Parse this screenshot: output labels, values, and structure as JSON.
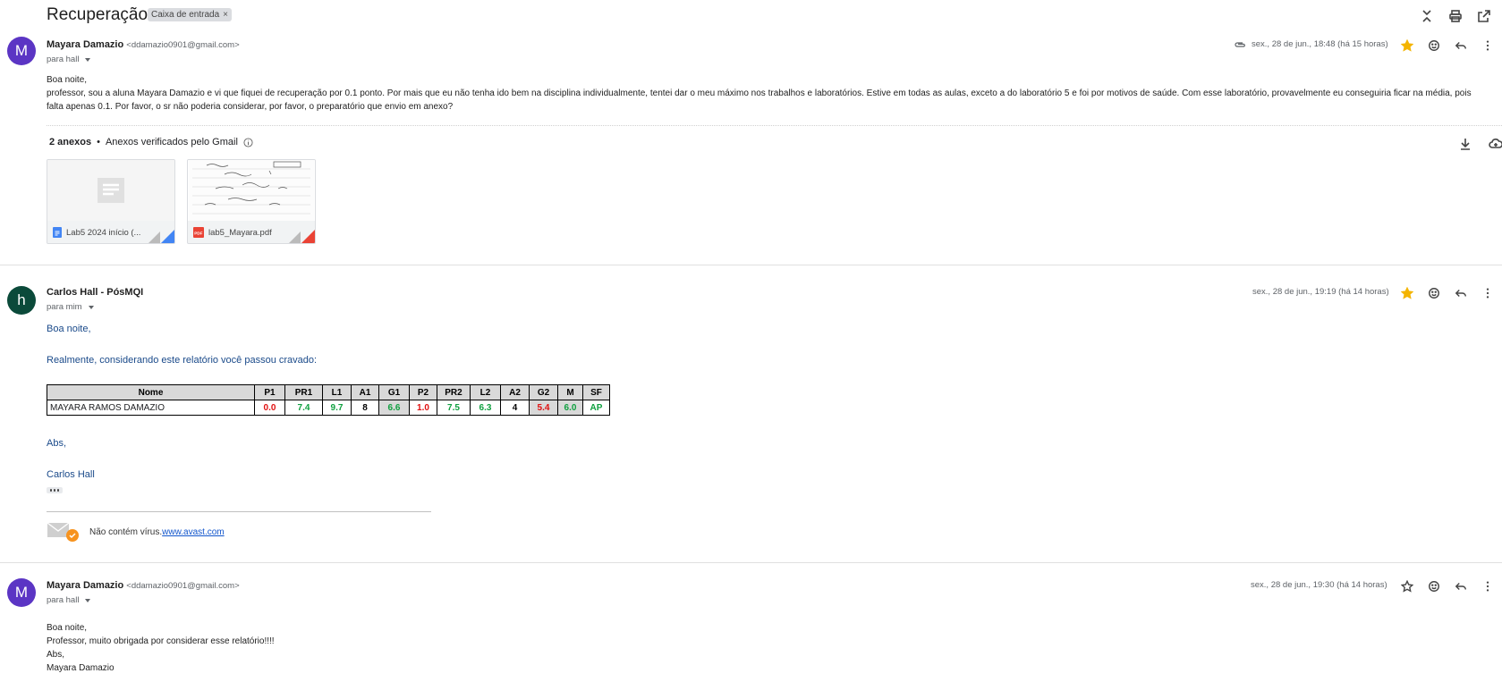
{
  "thread": {
    "subject": "Recuperação",
    "label": "Caixa de entrada"
  },
  "messages": [
    {
      "avatar_letter": "M",
      "avatar_color": "#5b35c4",
      "sender": "Mayara Damazio",
      "email": "<ddamazio0901@gmail.com>",
      "to": "para hall",
      "date": "sex., 28 de jun., 18:48 (há 15 horas)",
      "starred": true,
      "greeting": "Boa noite,",
      "body": "professor, sou a aluna Mayara Damazio e vi que fiquei de recuperação por 0.1 ponto. Por mais que eu não tenha ido bem na disciplina individualmente, tentei dar o meu máximo nos trabalhos e laboratórios. Estive em todas as aulas, exceto a do laboratório 5 e foi por motivos de saúde. Com esse laboratório, provavelmente eu conseguiria ficar na média, pois falta apenas 0.1. Por favor, o sr não poderia considerar, por favor, o preparatório que envio em anexo?",
      "attachments_count": "2 anexos",
      "attachments_verified": "Anexos verificados pelo Gmail",
      "attachments": [
        {
          "name": "Lab5 2024 início (...",
          "type": "doc"
        },
        {
          "name": "lab5_Mayara.pdf",
          "type": "pdf"
        }
      ]
    },
    {
      "avatar_letter": "h",
      "avatar_color": "#0b4a3a",
      "sender": "Carlos Hall - PósMQI",
      "to": "para mim",
      "date": "sex., 28 de jun., 19:19 (há 14 horas)",
      "starred": true,
      "greeting": "Boa noite,",
      "line1": "Realmente, considerando este relatório você passou cravado:",
      "table": {
        "headers": [
          "Nome",
          "P1",
          "PR1",
          "L1",
          "A1",
          "G1",
          "P2",
          "PR2",
          "L2",
          "A2",
          "G2",
          "M",
          "SF"
        ],
        "row": [
          "MAYARA RAMOS DAMAZIO",
          "0.0",
          "7.4",
          "9.7",
          "8",
          "6.6",
          "1.0",
          "7.5",
          "6.3",
          "4",
          "5.4",
          "6.0",
          "AP"
        ]
      },
      "signoff": "Abs,",
      "signature": "Carlos Hall",
      "virus_text": "Não contém vírus.",
      "virus_link": "www.avast.com"
    },
    {
      "avatar_letter": "M",
      "avatar_color": "#5b35c4",
      "sender": "Mayara Damazio",
      "email": "<ddamazio0901@gmail.com>",
      "to": "para hall",
      "date": "sex., 28 de jun., 19:30 (há 14 horas)",
      "starred": false,
      "lines": [
        "Boa noite,",
        "Professor, muito obrigada por considerar esse relatório!!!!",
        "Abs,",
        "Mayara Damazio"
      ]
    }
  ]
}
